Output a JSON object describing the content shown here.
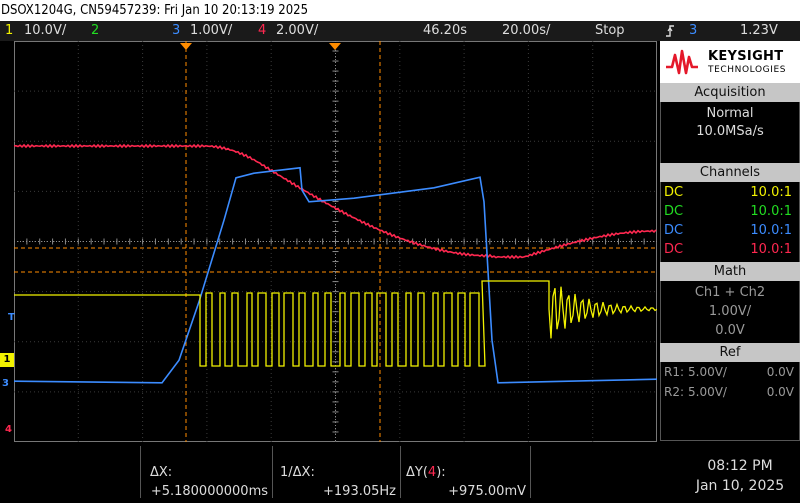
{
  "title": "DSOX1204G, CN59457239: Fri Jan 10 20:13:19 2025",
  "channel_bar": {
    "ch1_num": "1",
    "ch1_scale": "10.0V/",
    "ch2_num": "2",
    "ch3_num": "3",
    "ch3_scale": "1.00V/",
    "ch4_num": "4",
    "ch4_scale": "2.00V/",
    "time_pos": "46.20s",
    "time_scale": "20.00s/",
    "run_state": "Stop",
    "trigger_icon": "trigger-edge-icon",
    "trigger_source": "3",
    "trigger_level": "1.23V"
  },
  "brand": {
    "name": "KEYSIGHT",
    "sub": "TECHNOLOGIES",
    "logo_icon": "keysight-wave-logo"
  },
  "acquisition": {
    "title": "Acquisition",
    "mode": "Normal",
    "rate": "10.0MSa/s"
  },
  "channels": {
    "title": "Channels",
    "rows": [
      {
        "coupling": "DC",
        "probe": "10.0:1",
        "color": "#f2f200"
      },
      {
        "coupling": "DC",
        "probe": "10.0:1",
        "color": "#22dd22"
      },
      {
        "coupling": "DC",
        "probe": "10.0:1",
        "color": "#3c8cff"
      },
      {
        "coupling": "DC",
        "probe": "10.0:1",
        "color": "#ff2850"
      }
    ]
  },
  "math": {
    "title": "Math",
    "expr": "Ch1 + Ch2",
    "scale": "1.00V/",
    "offset": "0.0V"
  },
  "ref": {
    "title": "Ref",
    "r1_label": "R1:",
    "r1_scale": "5.00V/",
    "r1_offset": "0.0V",
    "r2_label": "R2:",
    "r2_scale": "5.00V/",
    "r2_offset": "0.0V"
  },
  "measurements": {
    "dx_label": "ΔX:",
    "dx_value": "+5.180000000ms",
    "inv_dx_label": "1/ΔX:",
    "inv_dx_value": "+193.05Hz",
    "dy_label_prefix": "ΔY(",
    "dy_channel": "4",
    "dy_label_suffix": "):",
    "dy_value": "+975.00mV"
  },
  "clock": {
    "time": "08:12 PM",
    "date": "Jan 10, 2025"
  },
  "markers": {
    "trig_level": "T",
    "ch1": "1",
    "ch3": "3",
    "ch4": "4"
  },
  "colors": {
    "ch1": "#f2f200",
    "ch2": "#22dd22",
    "ch3": "#3c8cff",
    "ch4": "#ff2850",
    "cursor": "#ff8c00"
  }
}
